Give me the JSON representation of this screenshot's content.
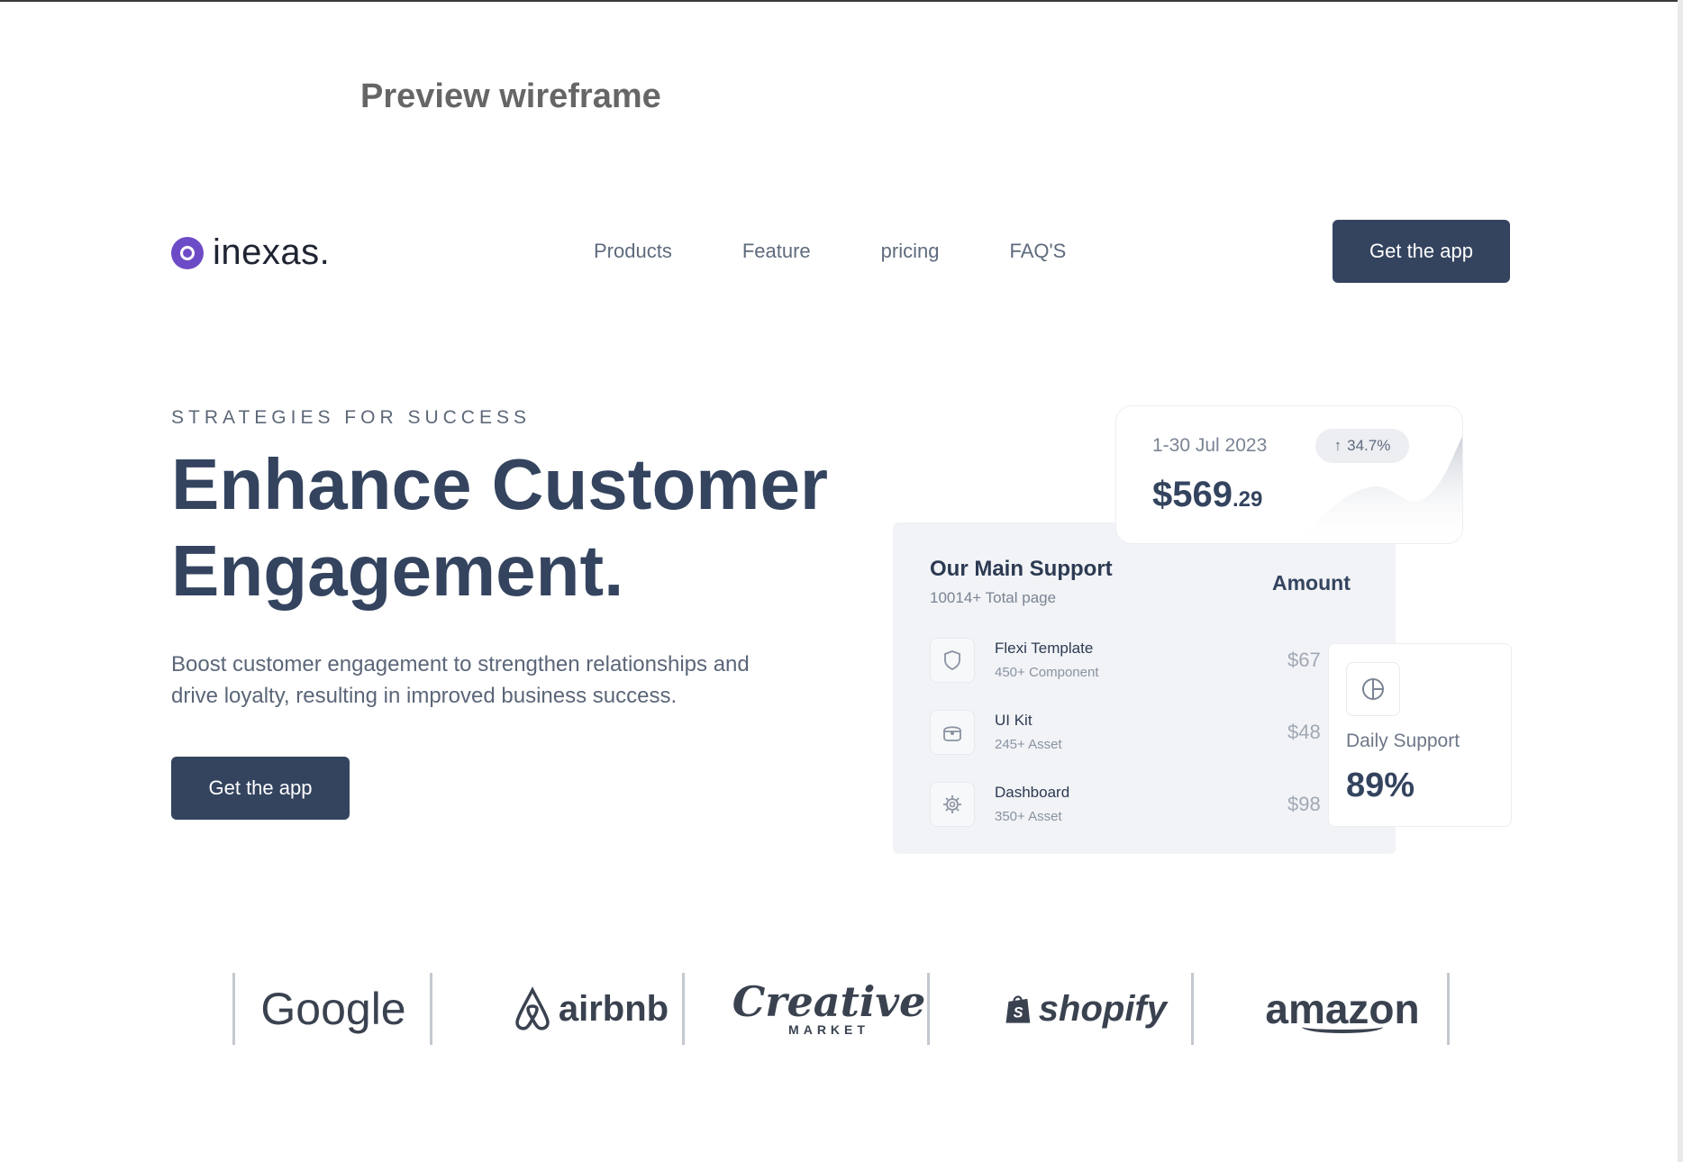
{
  "page": {
    "label": "Preview wireframe"
  },
  "brand": {
    "name": "inexas."
  },
  "nav": {
    "links": [
      "Products",
      "Feature",
      "pricing",
      "FAQ'S"
    ],
    "cta": "Get the app"
  },
  "hero": {
    "eyebrow": "STRATEGIES FOR SUCCESS",
    "headline_line1": "Enhance Customer",
    "headline_line2": "Engagement.",
    "description": "Boost customer engagement to strengthen relationships and drive loyalty, resulting in improved business success.",
    "cta": "Get the app"
  },
  "support_card": {
    "title": "Our Main Support",
    "subtitle": "10014+ Total page",
    "amount_label": "Amount",
    "rows": [
      {
        "name": "Flexi Template",
        "meta": "450+ Component",
        "price": "$67",
        "icon": "shield-icon"
      },
      {
        "name": "UI Kit",
        "meta": "245+ Asset",
        "price": "$48",
        "icon": "box-icon"
      },
      {
        "name": "Dashboard",
        "meta": "350+ Asset",
        "price": "$98",
        "icon": "gear-icon"
      }
    ]
  },
  "revenue_card": {
    "date_range": "1-30 Jul 2023",
    "change": "34.7%",
    "value_main": "$569",
    "value_cents": ".29"
  },
  "daily_card": {
    "label": "Daily Support",
    "value": "89%",
    "icon": "pie-chart-icon"
  },
  "partners": [
    "Google",
    "airbnb",
    "Creative",
    "MARKET",
    "shopify",
    "amazon"
  ],
  "colors": {
    "primary": "#34445f",
    "logo": "#6e4bc6",
    "card_bg": "#f1f3f6"
  }
}
